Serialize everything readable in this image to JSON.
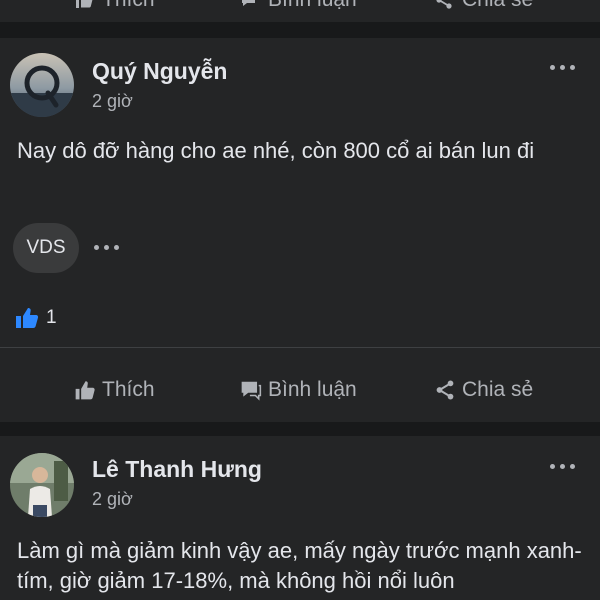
{
  "top_strip": {
    "like_label": "Thích",
    "comment_label": "Bình luận",
    "share_label": "Chia sẻ"
  },
  "posts": [
    {
      "author": "Quý Nguyễn",
      "time": "2 giờ",
      "text": "Nay dô đỡ hàng cho ae nhé, còn 800 cổ ai bán lun đi",
      "tag_chip": "VDS",
      "like_count": "1",
      "actions": {
        "like_label": "Thích",
        "comment_label": "Bình luận",
        "share_label": "Chia sẻ"
      }
    },
    {
      "author": "Lê Thanh Hưng",
      "time": "2 giờ",
      "text": "Làm gì mà giảm kinh vậy ae, mấy ngày trước mạnh xanh-tím, giờ giảm 17-18%, mà không hồi nổi luôn"
    }
  ],
  "colors": {
    "background": "#18191a",
    "card": "#242526",
    "text_primary": "#e4e6eb",
    "text_secondary": "#b0b3b8",
    "like_blue": "#2d88ff"
  }
}
